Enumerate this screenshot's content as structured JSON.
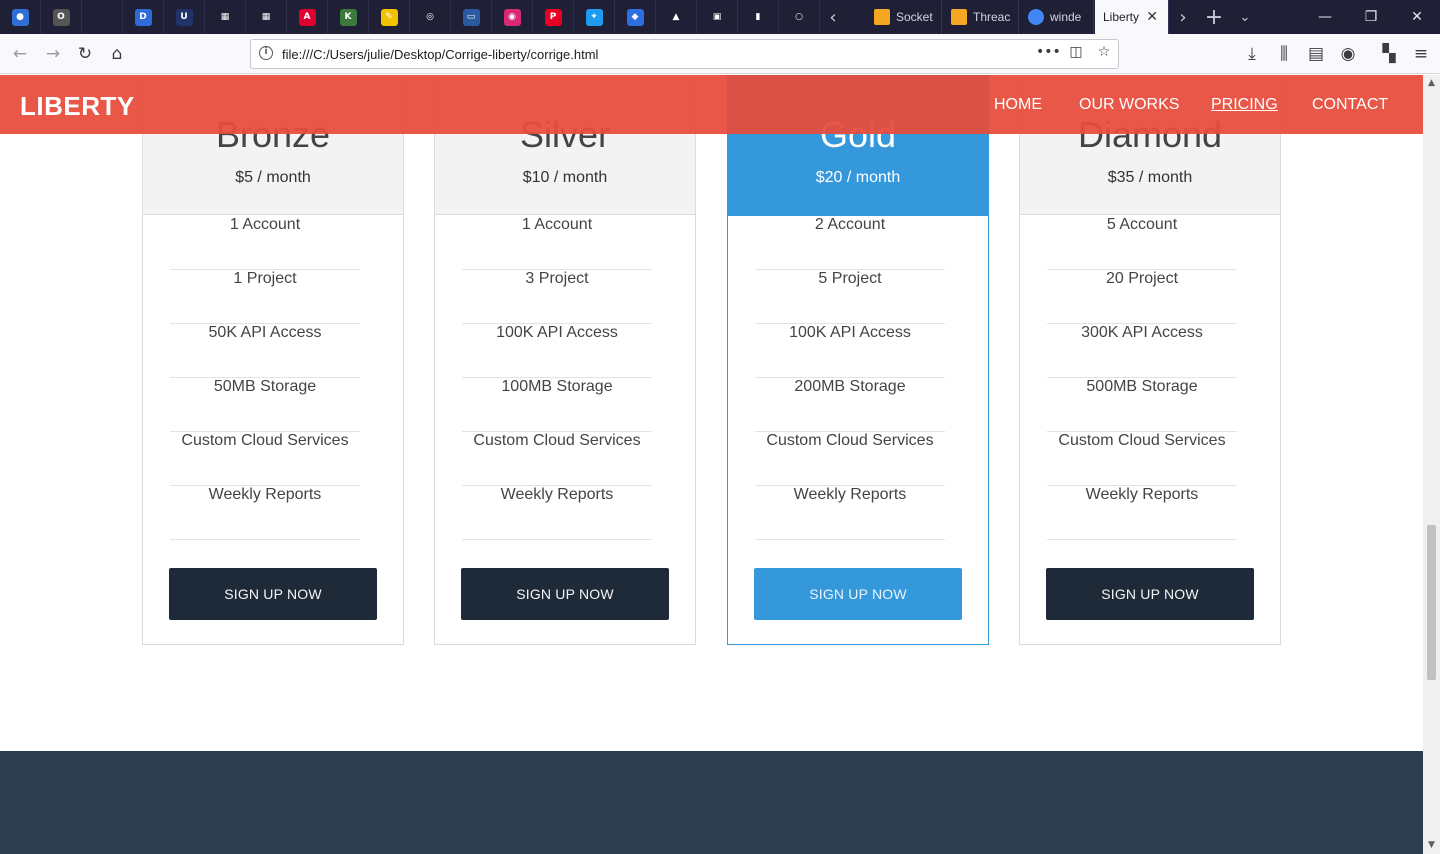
{
  "browser": {
    "pinned_tabs": [
      {
        "icon": "firefox-icon",
        "color": "#2f6fd6",
        "glyph": "●"
      },
      {
        "icon": "key-icon",
        "color": "#555555",
        "glyph": "O"
      },
      {
        "icon": "blank-icon",
        "color": "#1f1f36",
        "glyph": ""
      },
      {
        "icon": "d-app-icon",
        "color": "#2e6bd6",
        "glyph": "D"
      },
      {
        "icon": "udemy-icon",
        "color": "#20336b",
        "glyph": "U"
      },
      {
        "icon": "microsoft-icon",
        "color": "#1f1f36",
        "glyph": "▦"
      },
      {
        "icon": "microsoft-store-icon",
        "color": "#1f1f36",
        "glyph": "▦"
      },
      {
        "icon": "angular-icon",
        "color": "#dd0031",
        "glyph": "A"
      },
      {
        "icon": "kle-icon",
        "color": "#3b7a3b",
        "glyph": "K"
      },
      {
        "icon": "pencil-icon",
        "color": "#f2c200",
        "glyph": "✎"
      },
      {
        "icon": "globe-icon",
        "color": "#1f1f36",
        "glyph": "◎"
      },
      {
        "icon": "screen-icon",
        "color": "#2c5aa0",
        "glyph": "▭"
      },
      {
        "icon": "instagram-icon",
        "color": "#d62976",
        "glyph": "◉"
      },
      {
        "icon": "pinterest-icon",
        "color": "#e60023",
        "glyph": "P"
      },
      {
        "icon": "twitter-icon",
        "color": "#1d9bf0",
        "glyph": "✦"
      },
      {
        "icon": "bookmark-icon",
        "color": "#2d6fe0",
        "glyph": "◆"
      },
      {
        "icon": "drive-icon",
        "color": "#1f1f36",
        "glyph": "▲"
      },
      {
        "icon": "briefcase-icon",
        "color": "#1f1f36",
        "glyph": "▣"
      },
      {
        "icon": "analytics-icon",
        "color": "#1f1f36",
        "glyph": "▮"
      },
      {
        "icon": "circle-icon",
        "color": "#1f1f36",
        "glyph": "○"
      }
    ],
    "tabs": [
      {
        "label": "Socket",
        "icon": "bing-icon"
      },
      {
        "label": "Threac",
        "icon": "bing-icon"
      },
      {
        "label": "winde",
        "icon": "google-icon"
      },
      {
        "label": "Liberty",
        "icon": "page-icon",
        "active": true
      }
    ],
    "url": "file:///C:/Users/julie/Desktop/Corrige-liberty/corrige.html"
  },
  "site": {
    "brand": "LIBERTY",
    "nav": [
      {
        "label": "HOME"
      },
      {
        "label": "OUR WORKS"
      },
      {
        "label": "PRICING",
        "current": true
      },
      {
        "label": "CONTACT"
      }
    ]
  },
  "pricing": [
    {
      "name": "Bronze",
      "price": "$5 / month",
      "features": [
        "1 Account",
        "1 Project",
        "50K API Access",
        "50MB Storage",
        "Custom Cloud Services",
        "Weekly Reports"
      ],
      "button": "SIGN UP NOW"
    },
    {
      "name": "Silver",
      "price": "$10 / month",
      "features": [
        "1 Account",
        "3 Project",
        "100K API Access",
        "100MB Storage",
        "Custom Cloud Services",
        "Weekly Reports"
      ],
      "button": "SIGN UP NOW"
    },
    {
      "name": "Gold",
      "price": "$20 / month",
      "features": [
        "2 Account",
        "5 Project",
        "100K API Access",
        "200MB Storage",
        "Custom Cloud Services",
        "Weekly Reports"
      ],
      "button": "SIGN UP NOW",
      "featured": true
    },
    {
      "name": "Diamond",
      "price": "$35 / month",
      "features": [
        "5 Account",
        "20 Project",
        "300K API Access",
        "500MB Storage",
        "Custom Cloud Services",
        "Weekly Reports"
      ],
      "button": "SIGN UP NOW"
    }
  ],
  "colors": {
    "header": "#e74c3c",
    "featured": "#3498db",
    "button_dark": "#1e2a38",
    "footer": "#2c3e50"
  }
}
